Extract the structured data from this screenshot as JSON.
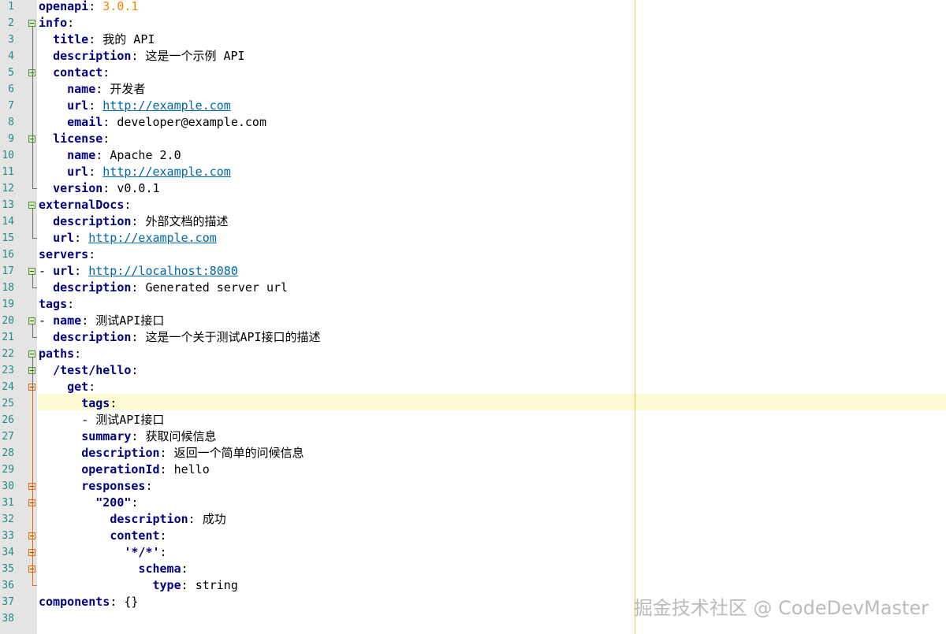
{
  "editor": {
    "line_numbers": [
      "1",
      "2",
      "3",
      "4",
      "5",
      "6",
      "7",
      "8",
      "9",
      "10",
      "11",
      "12",
      "13",
      "14",
      "15",
      "16",
      "17",
      "18",
      "19",
      "20",
      "21",
      "22",
      "23",
      "24",
      "25",
      "26",
      "27",
      "28",
      "29",
      "30",
      "31",
      "32",
      "33",
      "34",
      "35",
      "36",
      "37",
      "38"
    ],
    "current_line": "25",
    "lines": [
      {
        "n": "1",
        "key": "openapi",
        "value": "3.0.1",
        "value_type": "number"
      },
      {
        "n": "2",
        "key": "info",
        "value": "",
        "value_type": "plain"
      },
      {
        "n": "3",
        "key": "title",
        "value": "我的 API",
        "value_type": "plain"
      },
      {
        "n": "4",
        "key": "description",
        "value": "这是一个示例 API",
        "value_type": "plain"
      },
      {
        "n": "5",
        "key": "contact",
        "value": "",
        "value_type": "plain"
      },
      {
        "n": "6",
        "key": "name",
        "value": "开发者",
        "value_type": "plain"
      },
      {
        "n": "7",
        "key": "url",
        "value": "http://example.com",
        "value_type": "url"
      },
      {
        "n": "8",
        "key": "email",
        "value": "developer@example.com",
        "value_type": "plain"
      },
      {
        "n": "9",
        "key": "license",
        "value": "",
        "value_type": "plain"
      },
      {
        "n": "10",
        "key": "name",
        "value": "Apache 2.0",
        "value_type": "plain"
      },
      {
        "n": "11",
        "key": "url",
        "value": "http://example.com",
        "value_type": "url"
      },
      {
        "n": "12",
        "key": "version",
        "value": "v0.0.1",
        "value_type": "plain"
      },
      {
        "n": "13",
        "key": "externalDocs",
        "value": "",
        "value_type": "plain"
      },
      {
        "n": "14",
        "key": "description",
        "value": "外部文档的描述",
        "value_type": "plain"
      },
      {
        "n": "15",
        "key": "url",
        "value": "http://example.com",
        "value_type": "url"
      },
      {
        "n": "16",
        "key": "servers",
        "value": "",
        "value_type": "plain"
      },
      {
        "n": "17",
        "key": "url",
        "value": "http://localhost:8080",
        "value_type": "url",
        "dash": "- "
      },
      {
        "n": "18",
        "key": "description",
        "value": "Generated server url",
        "value_type": "plain"
      },
      {
        "n": "19",
        "key": "tags",
        "value": "",
        "value_type": "plain"
      },
      {
        "n": "20",
        "key": "name",
        "value": "测试API接口",
        "value_type": "plain",
        "dash": "- "
      },
      {
        "n": "21",
        "key": "description",
        "value": "这是一个关于测试API接口的描述",
        "value_type": "plain"
      },
      {
        "n": "22",
        "key": "paths",
        "value": "",
        "value_type": "plain"
      },
      {
        "n": "23",
        "key": "/test/hello",
        "value": "",
        "value_type": "plain"
      },
      {
        "n": "24",
        "key": "get",
        "value": "",
        "value_type": "plain"
      },
      {
        "n": "25",
        "key": "tags",
        "value": "",
        "value_type": "plain"
      },
      {
        "n": "26",
        "key": "",
        "value": "- 测试API接口",
        "value_type": "plain"
      },
      {
        "n": "27",
        "key": "summary",
        "value": "获取问候信息",
        "value_type": "plain"
      },
      {
        "n": "28",
        "key": "description",
        "value": "返回一个简单的问候信息",
        "value_type": "plain"
      },
      {
        "n": "29",
        "key": "operationId",
        "value": "hello",
        "value_type": "plain"
      },
      {
        "n": "30",
        "key": "responses",
        "value": "",
        "value_type": "plain"
      },
      {
        "n": "31",
        "key": "\"200\"",
        "value": "",
        "value_type": "plain"
      },
      {
        "n": "32",
        "key": "description",
        "value": "成功",
        "value_type": "plain"
      },
      {
        "n": "33",
        "key": "content",
        "value": "",
        "value_type": "plain"
      },
      {
        "n": "34",
        "key": "'*/*'",
        "value": "",
        "value_type": "plain"
      },
      {
        "n": "35",
        "key": "schema",
        "value": "",
        "value_type": "plain"
      },
      {
        "n": "36",
        "key": "type",
        "value": "string",
        "value_type": "plain"
      },
      {
        "n": "37",
        "key": "components",
        "value": "{}",
        "value_type": "plain"
      },
      {
        "n": "38",
        "key": "",
        "value": "",
        "value_type": "plain"
      }
    ]
  },
  "watermark": "掘金技术社区 @ CodeDevMaster",
  "colors": {
    "gutter_bg": "#e4e4e4",
    "line_number": "#238a8a",
    "key": "#000080",
    "number": "#ff8000",
    "url": "#0066aa",
    "current_line_bg": "#fdfbd3",
    "edge_line": "#f0c040",
    "active_fold": "#e26b1a"
  }
}
